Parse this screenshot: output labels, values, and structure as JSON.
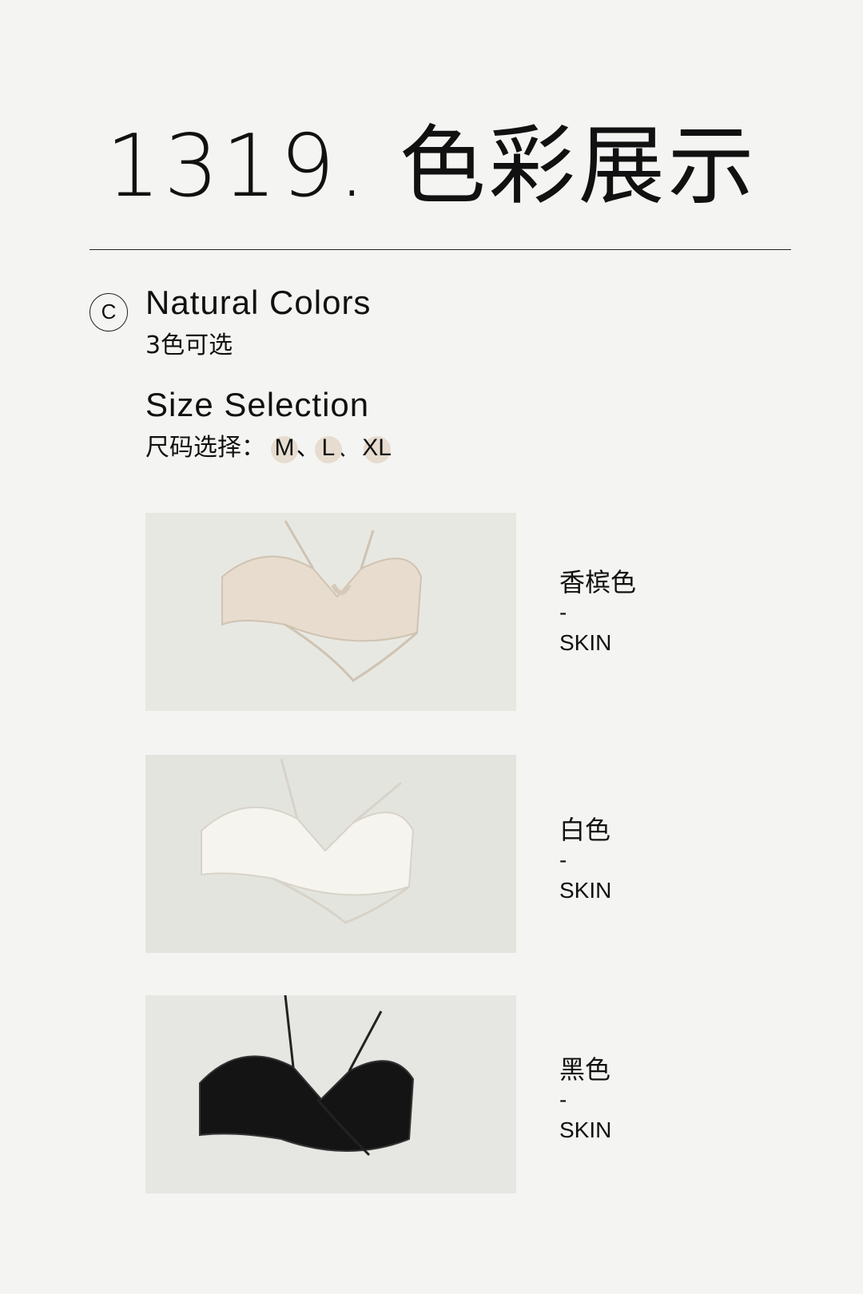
{
  "header": {
    "title": "1319. 色彩展示"
  },
  "section": {
    "badge": "C",
    "colors_heading": "Natural Colors",
    "colors_sub": "3色可选",
    "size_heading": "Size Selection",
    "size_prefix": "尺码选择：",
    "sizes": [
      "M",
      "L",
      "XL"
    ],
    "separator": "、"
  },
  "variants": [
    {
      "name": "香槟色",
      "dash": "-",
      "en": "SKIN",
      "color": "#e7dccd",
      "background": "#e8e8e3"
    },
    {
      "name": "白色",
      "dash": "-",
      "en": "SKIN",
      "color": "#f6f4ee",
      "background": "#e4e4df"
    },
    {
      "name": "黑色",
      "dash": "-",
      "en": "SKIN",
      "color": "#141414",
      "background": "#e6e6e2"
    }
  ]
}
